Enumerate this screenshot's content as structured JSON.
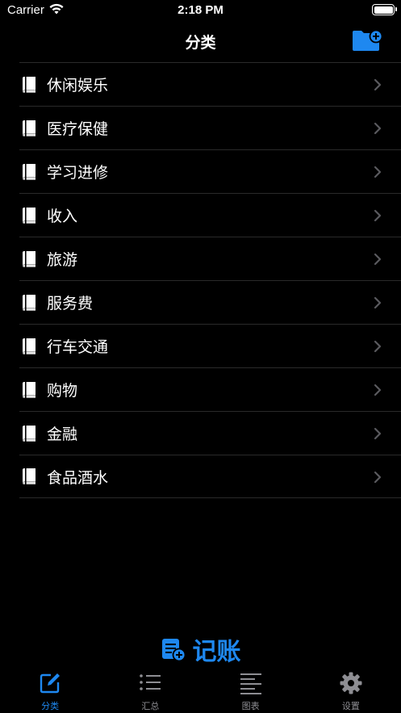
{
  "status_bar": {
    "carrier": "Carrier",
    "time": "2:18 PM"
  },
  "nav": {
    "title": "分类",
    "add_icon": "folder-add-icon"
  },
  "categories": [
    {
      "label": "休闲娱乐"
    },
    {
      "label": "医疗保健"
    },
    {
      "label": "学习进修"
    },
    {
      "label": "收入"
    },
    {
      "label": "旅游"
    },
    {
      "label": "服务费"
    },
    {
      "label": "行车交通"
    },
    {
      "label": "购物"
    },
    {
      "label": "金融"
    },
    {
      "label": "食品酒水"
    }
  ],
  "record_button": {
    "label": "记账",
    "icon": "note-add-icon"
  },
  "tabs": [
    {
      "label": "分类",
      "icon": "edit-icon",
      "active": true
    },
    {
      "label": "汇总",
      "icon": "list-icon",
      "active": false
    },
    {
      "label": "图表",
      "icon": "text-align-icon",
      "active": false
    },
    {
      "label": "设置",
      "icon": "gear-icon",
      "active": false
    }
  ],
  "colors": {
    "accent": "#1e88f0",
    "background": "#000000",
    "inactive": "#8e8e93"
  }
}
